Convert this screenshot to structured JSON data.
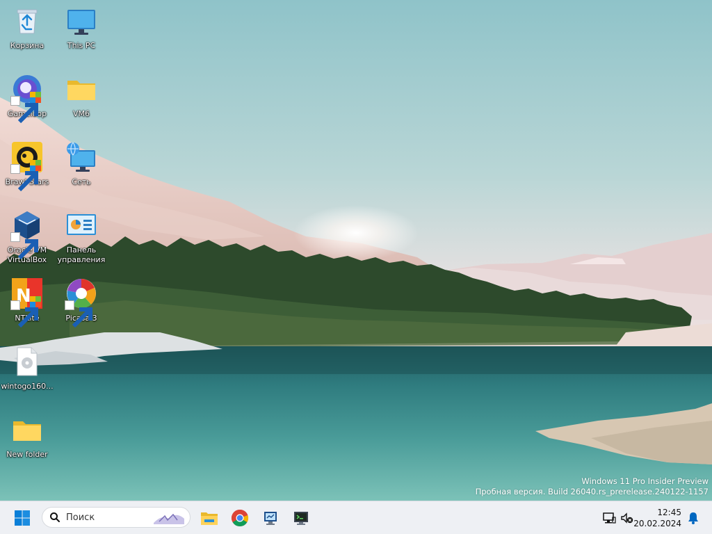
{
  "desktop": {
    "icons": [
      {
        "label": "Корзина",
        "icon": "recycle-bin-icon"
      },
      {
        "label": "This PC",
        "icon": "monitor-icon"
      },
      {
        "label": "Gameloop",
        "icon": "gameloop-icon"
      },
      {
        "label": "VM6",
        "icon": "folder-icon"
      },
      {
        "label": "Brawl Stars",
        "icon": "brawl-stars-icon"
      },
      {
        "label": "Сеть",
        "icon": "network-icon"
      },
      {
        "label": "Oracle VM VirtualBox",
        "icon": "virtualbox-icon"
      },
      {
        "label": "Панель управления",
        "icon": "control-panel-icon"
      },
      {
        "label": "NTLite",
        "icon": "ntlite-icon"
      },
      {
        "label": "Picasa 3",
        "icon": "picasa-icon"
      },
      {
        "label": "wintogo160...",
        "icon": "file-icon"
      },
      {
        "label": "New folder",
        "icon": "folder-icon"
      }
    ],
    "watermark": {
      "line1": "Windows 11 Pro Insider Preview",
      "line2": "Пробная версия. Build 26040.rs_prerelease.240122-1157"
    }
  },
  "taskbar": {
    "start_icon": "windows-logo-icon",
    "search": {
      "placeholder": "Поиск"
    },
    "pinned": [
      {
        "icon": "file-explorer-icon"
      },
      {
        "icon": "chrome-icon"
      },
      {
        "icon": "monitor-app-icon"
      },
      {
        "icon": "terminal-app-icon"
      }
    ],
    "tray": {
      "time": "12:45",
      "date": "20.02.2024"
    }
  },
  "colors": {
    "taskbar_bg": "#eef0f4",
    "accent": "#0067c0"
  }
}
